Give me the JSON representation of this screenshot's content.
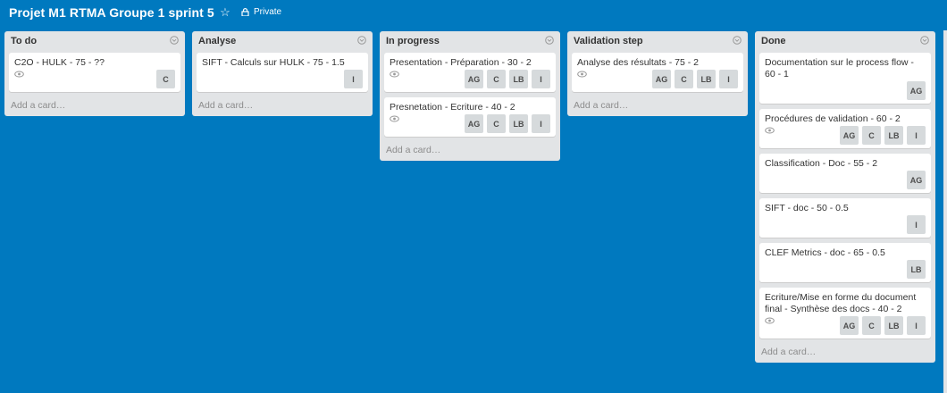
{
  "board": {
    "title": "Projet M1 RTMA Groupe 1 sprint 5",
    "privacy": "Private"
  },
  "add_card_label": "Add a card…",
  "lists": [
    {
      "title": "To do",
      "cards": [
        {
          "title": "C2O - HULK - 75 - ??",
          "watch": true,
          "members": [
            "C"
          ]
        }
      ]
    },
    {
      "title": "Analyse",
      "cards": [
        {
          "title": "SIFT - Calculs sur HULK - 75 - 1.5",
          "watch": false,
          "members": [
            "I"
          ]
        }
      ]
    },
    {
      "title": "In progress",
      "cards": [
        {
          "title": "Presentation - Préparation - 30 - 2",
          "watch": true,
          "members": [
            "AG",
            "C",
            "LB",
            "I"
          ]
        },
        {
          "title": "Presnetation - Ecriture - 40 - 2",
          "watch": true,
          "members": [
            "AG",
            "C",
            "LB",
            "I"
          ]
        }
      ]
    },
    {
      "title": "Validation step",
      "cards": [
        {
          "title": "Analyse des résultats - 75 - 2",
          "watch": true,
          "members": [
            "AG",
            "C",
            "LB",
            "I"
          ]
        }
      ]
    },
    {
      "title": "Done",
      "cards": [
        {
          "title": "Documentation sur le process flow - 60 - 1",
          "watch": false,
          "members": [
            "AG"
          ]
        },
        {
          "title": "Procédures de validation - 60 - 2",
          "watch": true,
          "members": [
            "AG",
            "C",
            "LB",
            "I"
          ]
        },
        {
          "title": "Classification - Doc - 55 - 2",
          "watch": false,
          "members": [
            "AG"
          ]
        },
        {
          "title": "SIFT - doc - 50 - 0.5",
          "watch": false,
          "members": [
            "I"
          ]
        },
        {
          "title": "CLEF Metrics - doc - 65 - 0.5",
          "watch": false,
          "members": [
            "LB"
          ]
        },
        {
          "title": "Ecriture/Mise en forme du document final - Synthèse des docs - 40 - 2",
          "watch": true,
          "members": [
            "AG",
            "C",
            "LB",
            "I"
          ]
        }
      ]
    }
  ]
}
